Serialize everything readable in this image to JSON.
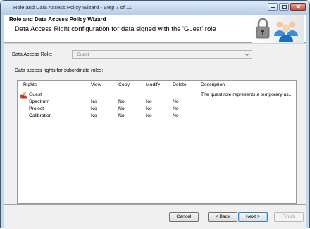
{
  "window": {
    "title": "Role and Data Access Policy Wizard - Step 7 of 11"
  },
  "header": {
    "title": "Role and Data Access Policy Wizard",
    "subtitle": "Data Access Right configuration for data signed with the 'Guest' role"
  },
  "role": {
    "label": "Data Access Role:",
    "value": "Guest"
  },
  "subroles": {
    "label": "Data access rights for subordinate roles:"
  },
  "grid": {
    "columns": [
      "Rights",
      "View",
      "Copy",
      "Modify",
      "Delete",
      "Description"
    ],
    "parent": {
      "name": "Guest",
      "description": "The guest role represents a temporary us..."
    },
    "rows": [
      {
        "name": "Spectrum",
        "view": "No",
        "copy": "No",
        "modify": "No",
        "delete": "No"
      },
      {
        "name": "Project",
        "view": "No",
        "copy": "No",
        "modify": "No",
        "delete": "No"
      },
      {
        "name": "Calibration",
        "view": "No",
        "copy": "No",
        "modify": "No",
        "delete": "No"
      }
    ]
  },
  "footer": {
    "cancel": "Cancel",
    "back": "< Back",
    "next": "Next >",
    "finish": "Finish"
  },
  "icons": {
    "header_lock": "lock-icon",
    "header_users": "users-icon",
    "guest_role": "role-icon",
    "minimize": "minimize-icon",
    "maximize": "maximize-icon",
    "close": "close-icon",
    "dropdown": "chevron-down-icon"
  }
}
